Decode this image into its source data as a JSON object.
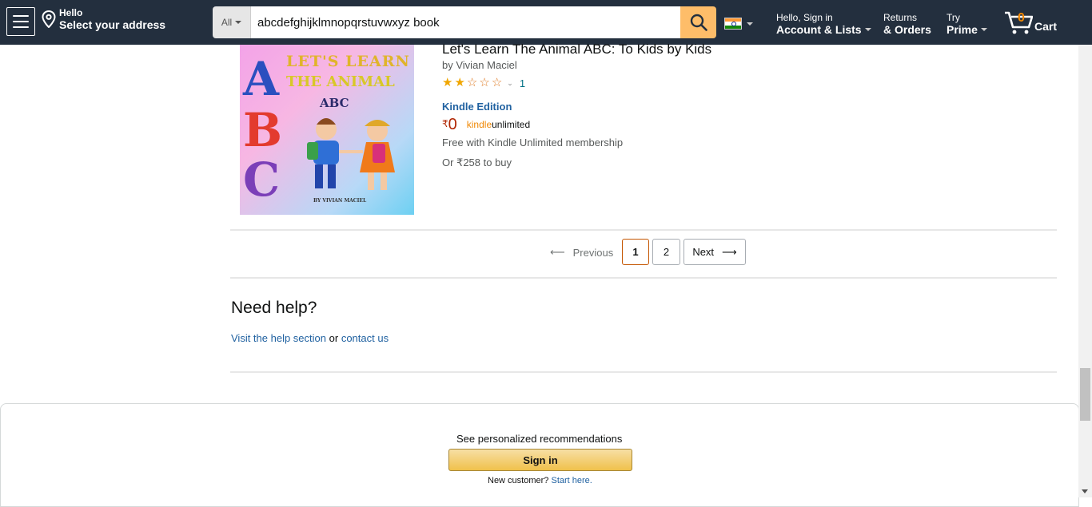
{
  "nav": {
    "location_hello": "Hello",
    "location_select": "Select your address",
    "search_category": "All",
    "search_value": "abcdefghijklmnopqrstuvwxyz book",
    "account_small": "Hello, Sign in",
    "account_big": "Account & Lists",
    "returns_small": "Returns",
    "returns_big": "& Orders",
    "prime_small": "Try",
    "prime_big": "Prime",
    "cart_count": "0",
    "cart_label": "Cart"
  },
  "product": {
    "cover": {
      "line1": "LET'S LEARN",
      "line2": "THE ANIMAL",
      "line3": "ABC",
      "letter_a": "A",
      "letter_b": "B",
      "letter_c": "C",
      "credit": "BY VIVIAN MACIEL"
    },
    "title": "Let's Learn The Animal ABC: To Kids by Kids",
    "author_prefix": "by",
    "author": "Vivian Maciel",
    "rating_count": "1",
    "rating_value": 2,
    "format": "Kindle Edition",
    "price_symbol": "₹",
    "price_whole": "0",
    "ku_kindle": "kindle",
    "ku_unlimited": "unlimited",
    "free_text": "Free with Kindle Unlimited membership",
    "or_buy": "Or ₹258 to buy"
  },
  "pagination": {
    "previous": "Previous",
    "pages": [
      "1",
      "2"
    ],
    "next": "Next"
  },
  "help": {
    "heading": "Need help?",
    "visit": "Visit the help section",
    "or": "or",
    "contact": "contact us"
  },
  "recommendations": {
    "see": "See personalized recommendations",
    "signin": "Sign in",
    "new_customer": "New customer?",
    "start_here": "Start here."
  }
}
